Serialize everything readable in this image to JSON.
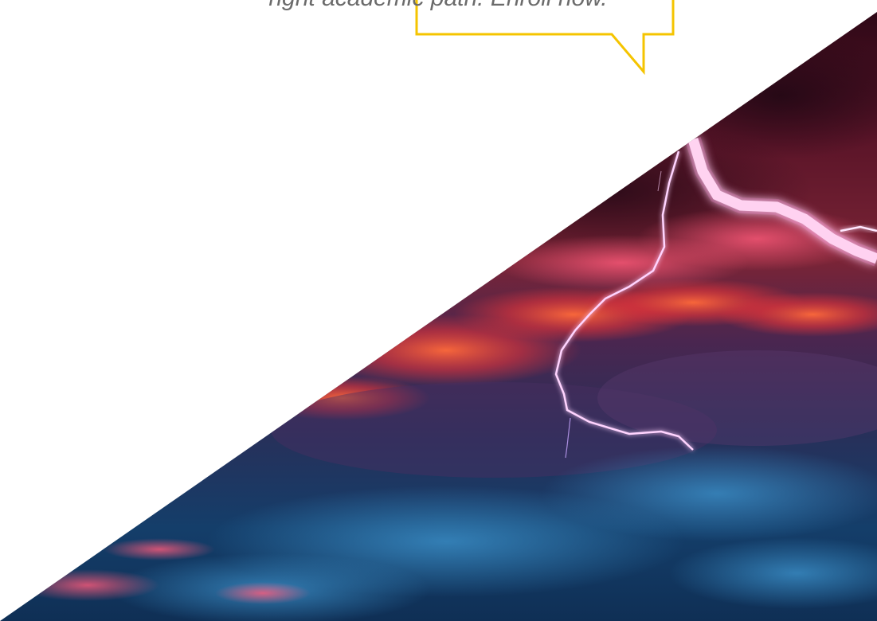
{
  "callout": {
    "text": "right academic path. Enroll now."
  },
  "colors": {
    "accent_yellow": "#f5c400",
    "text_gray": "#6b6b6b",
    "sky_top": "#3a0a1e",
    "sky_red": "#ff4a2a",
    "sky_blue": "#123f6e",
    "lightning": "#ffd9ff"
  },
  "images": {
    "hero": "storm-clouds-with-lightning"
  }
}
